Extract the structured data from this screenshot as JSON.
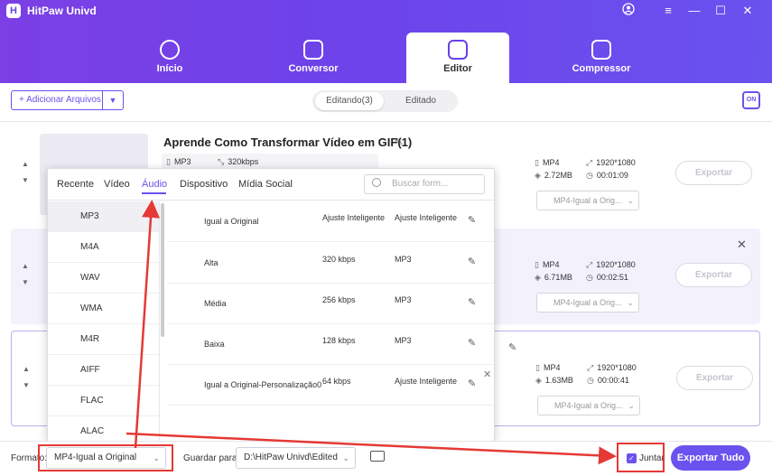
{
  "app": {
    "title": "HitPaw Univd",
    "logo": "H"
  },
  "window_controls": [
    "user-icon",
    "menu-icon",
    "minimize-icon",
    "maximize-icon",
    "close-icon"
  ],
  "tabs": [
    {
      "label": "Início",
      "icon": "home-icon"
    },
    {
      "label": "Conversor",
      "icon": "convert-icon"
    },
    {
      "label": "Editor",
      "icon": "editor-icon",
      "active": true
    },
    {
      "label": "Compressor",
      "icon": "compress-icon"
    }
  ],
  "toolbar": {
    "add_label": "+ Adicionar Arquivos",
    "seg_editing": "Editando(3)",
    "seg_edited": "Editado",
    "corner_label": "ON"
  },
  "files": [
    {
      "title": "Aprende Como Transformar Vídeo em GIF(1)",
      "in_format": "MP3",
      "in_bitrate": "320kbps",
      "out_format": "MP4",
      "out_res": "1920*1080",
      "out_size": "2.72MB",
      "out_dur": "00:01:09",
      "export": "Exportar",
      "format_select": "MP4-Igual a Orig..."
    },
    {
      "title": "",
      "out_format": "MP4",
      "out_res": "1920*1080",
      "out_size": "6.71MB",
      "out_dur": "00:02:51",
      "export": "Exportar",
      "format_select": "MP4-Igual a Orig..."
    },
    {
      "title": "",
      "out_format": "MP4",
      "out_res": "1920*1080",
      "out_size": "1.63MB",
      "out_dur": "00:00:41",
      "export": "Exportar",
      "format_select": "MP4-Igual a Orig..."
    }
  ],
  "panel": {
    "tabs": [
      "Recente",
      "Vídeo",
      "Áudio",
      "Dispositivo",
      "Mídia Social"
    ],
    "active_tab": "Áudio",
    "search_placeholder": "Buscar form...",
    "formats": [
      "MP3",
      "M4A",
      "WAV",
      "WMA",
      "M4R",
      "AIFF",
      "FLAC",
      "ALAC"
    ],
    "selected_format": "MP3",
    "options": [
      {
        "name": "Igual a Original",
        "bitrate": "Ajuste Inteligente",
        "codec": "Ajuste Inteligente"
      },
      {
        "name": "Alta",
        "bitrate": "320 kbps",
        "codec": "MP3"
      },
      {
        "name": "Média",
        "bitrate": "256 kbps",
        "codec": "MP3"
      },
      {
        "name": "Baixa",
        "bitrate": "128 kbps",
        "codec": "MP3"
      },
      {
        "name": "Igual a Original-Personalização0",
        "bitrate": "64 kbps",
        "codec": "Ajuste Inteligente"
      }
    ]
  },
  "footer": {
    "format_label": "Formato:",
    "format_value": "MP4-Igual a Original",
    "save_label": "Guardar para:",
    "save_value": "D:\\HitPaw Univd\\Edited",
    "merge_label": "Juntar",
    "merge_checked": true,
    "export_all": "Exportar Tudo"
  },
  "colors": {
    "accent": "#6a52ef",
    "header_start": "#7b3fe4",
    "annotation": "#e53935"
  }
}
